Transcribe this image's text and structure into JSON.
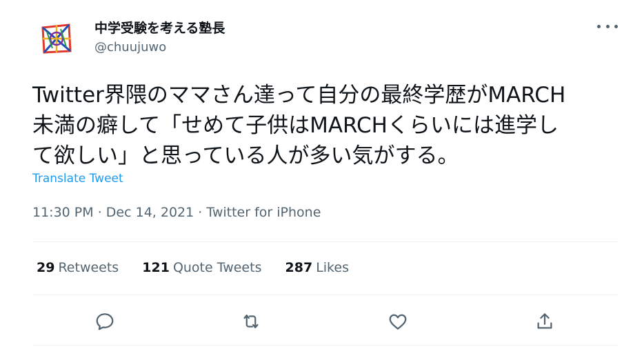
{
  "user": {
    "display_name": "中学受験を考える塾長",
    "handle": "@chuujuwo"
  },
  "tweet": {
    "lines": [
      "Twitter界隈のママさん達って自分の最終学歴がMARCH",
      "未満の癖して「せめて子供はMARCHくらいには進学し",
      "て欲しい」と思っている人が多い気がする。"
    ],
    "translate_label": "Translate Tweet",
    "time": "11:30 PM",
    "date": "Dec 14, 2021",
    "source": "Twitter for iPhone"
  },
  "stats": {
    "retweets_count": "29",
    "retweets_label": "Retweets",
    "quotes_count": "121",
    "quotes_label": "Quote Tweets",
    "likes_count": "287",
    "likes_label": "Likes"
  },
  "icons": {
    "more": "more-icon",
    "reply": "reply-icon",
    "retweet": "retweet-icon",
    "like": "heart-icon",
    "share": "share-icon"
  },
  "colors": {
    "primary_text": "#0f1419",
    "secondary_text": "#536471",
    "link": "#1d9bf0",
    "divider": "#eff3f4"
  }
}
